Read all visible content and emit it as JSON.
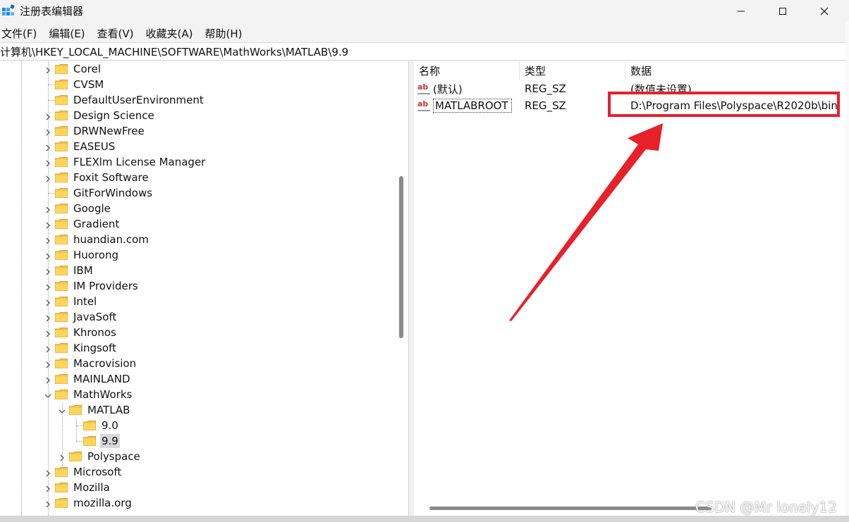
{
  "window": {
    "title": "注册表编辑器",
    "icon": "regedit-icon"
  },
  "menu": [
    "文件(F)",
    "编辑(E)",
    "查看(V)",
    "收藏夹(A)",
    "帮助(H)"
  ],
  "address": "计算机\\HKEY_LOCAL_MACHINE\\SOFTWARE\\MathWorks\\MATLAB\\9.9",
  "tree": [
    {
      "label": "Corel",
      "depth": 0,
      "state": "collapsed"
    },
    {
      "label": "CVSM",
      "depth": 0,
      "state": "leaf"
    },
    {
      "label": "DefaultUserEnvironment",
      "depth": 0,
      "state": "leaf"
    },
    {
      "label": "Design Science",
      "depth": 0,
      "state": "collapsed"
    },
    {
      "label": "DRWNewFree",
      "depth": 0,
      "state": "collapsed"
    },
    {
      "label": "EASEUS",
      "depth": 0,
      "state": "collapsed"
    },
    {
      "label": "FLEXlm License Manager",
      "depth": 0,
      "state": "collapsed"
    },
    {
      "label": "Foxit Software",
      "depth": 0,
      "state": "collapsed"
    },
    {
      "label": "GitForWindows",
      "depth": 0,
      "state": "leaf"
    },
    {
      "label": "Google",
      "depth": 0,
      "state": "collapsed"
    },
    {
      "label": "Gradient",
      "depth": 0,
      "state": "collapsed"
    },
    {
      "label": "huandian.com",
      "depth": 0,
      "state": "collapsed"
    },
    {
      "label": "Huorong",
      "depth": 0,
      "state": "collapsed"
    },
    {
      "label": "IBM",
      "depth": 0,
      "state": "collapsed"
    },
    {
      "label": "IM Providers",
      "depth": 0,
      "state": "collapsed"
    },
    {
      "label": "Intel",
      "depth": 0,
      "state": "collapsed"
    },
    {
      "label": "JavaSoft",
      "depth": 0,
      "state": "collapsed"
    },
    {
      "label": "Khronos",
      "depth": 0,
      "state": "collapsed"
    },
    {
      "label": "Kingsoft",
      "depth": 0,
      "state": "collapsed"
    },
    {
      "label": "Macrovision",
      "depth": 0,
      "state": "collapsed"
    },
    {
      "label": "MAINLAND",
      "depth": 0,
      "state": "collapsed"
    },
    {
      "label": "MathWorks",
      "depth": 0,
      "state": "expanded"
    },
    {
      "label": "MATLAB",
      "depth": 1,
      "state": "expanded"
    },
    {
      "label": "9.0",
      "depth": 2,
      "state": "leaf"
    },
    {
      "label": "9.9",
      "depth": 2,
      "state": "leaf",
      "selected": true
    },
    {
      "label": "Polyspace",
      "depth": 1,
      "state": "collapsed"
    },
    {
      "label": "Microsoft",
      "depth": 0,
      "state": "collapsed"
    },
    {
      "label": "Mozilla",
      "depth": 0,
      "state": "collapsed"
    },
    {
      "label": "mozilla.org",
      "depth": 0,
      "state": "collapsed"
    }
  ],
  "values": {
    "columns": [
      "名称",
      "类型",
      "数据"
    ],
    "rows": [
      {
        "name": "(默认)",
        "type": "REG_SZ",
        "data": "(数值未设置)"
      },
      {
        "name": "MATLABROOT",
        "type": "REG_SZ",
        "data": "D:\\Program Files\\Polyspace\\R2020b\\bin"
      }
    ]
  },
  "annotation": {
    "color": "#e8202a"
  },
  "watermark": "CSDN @Mr lonely12"
}
